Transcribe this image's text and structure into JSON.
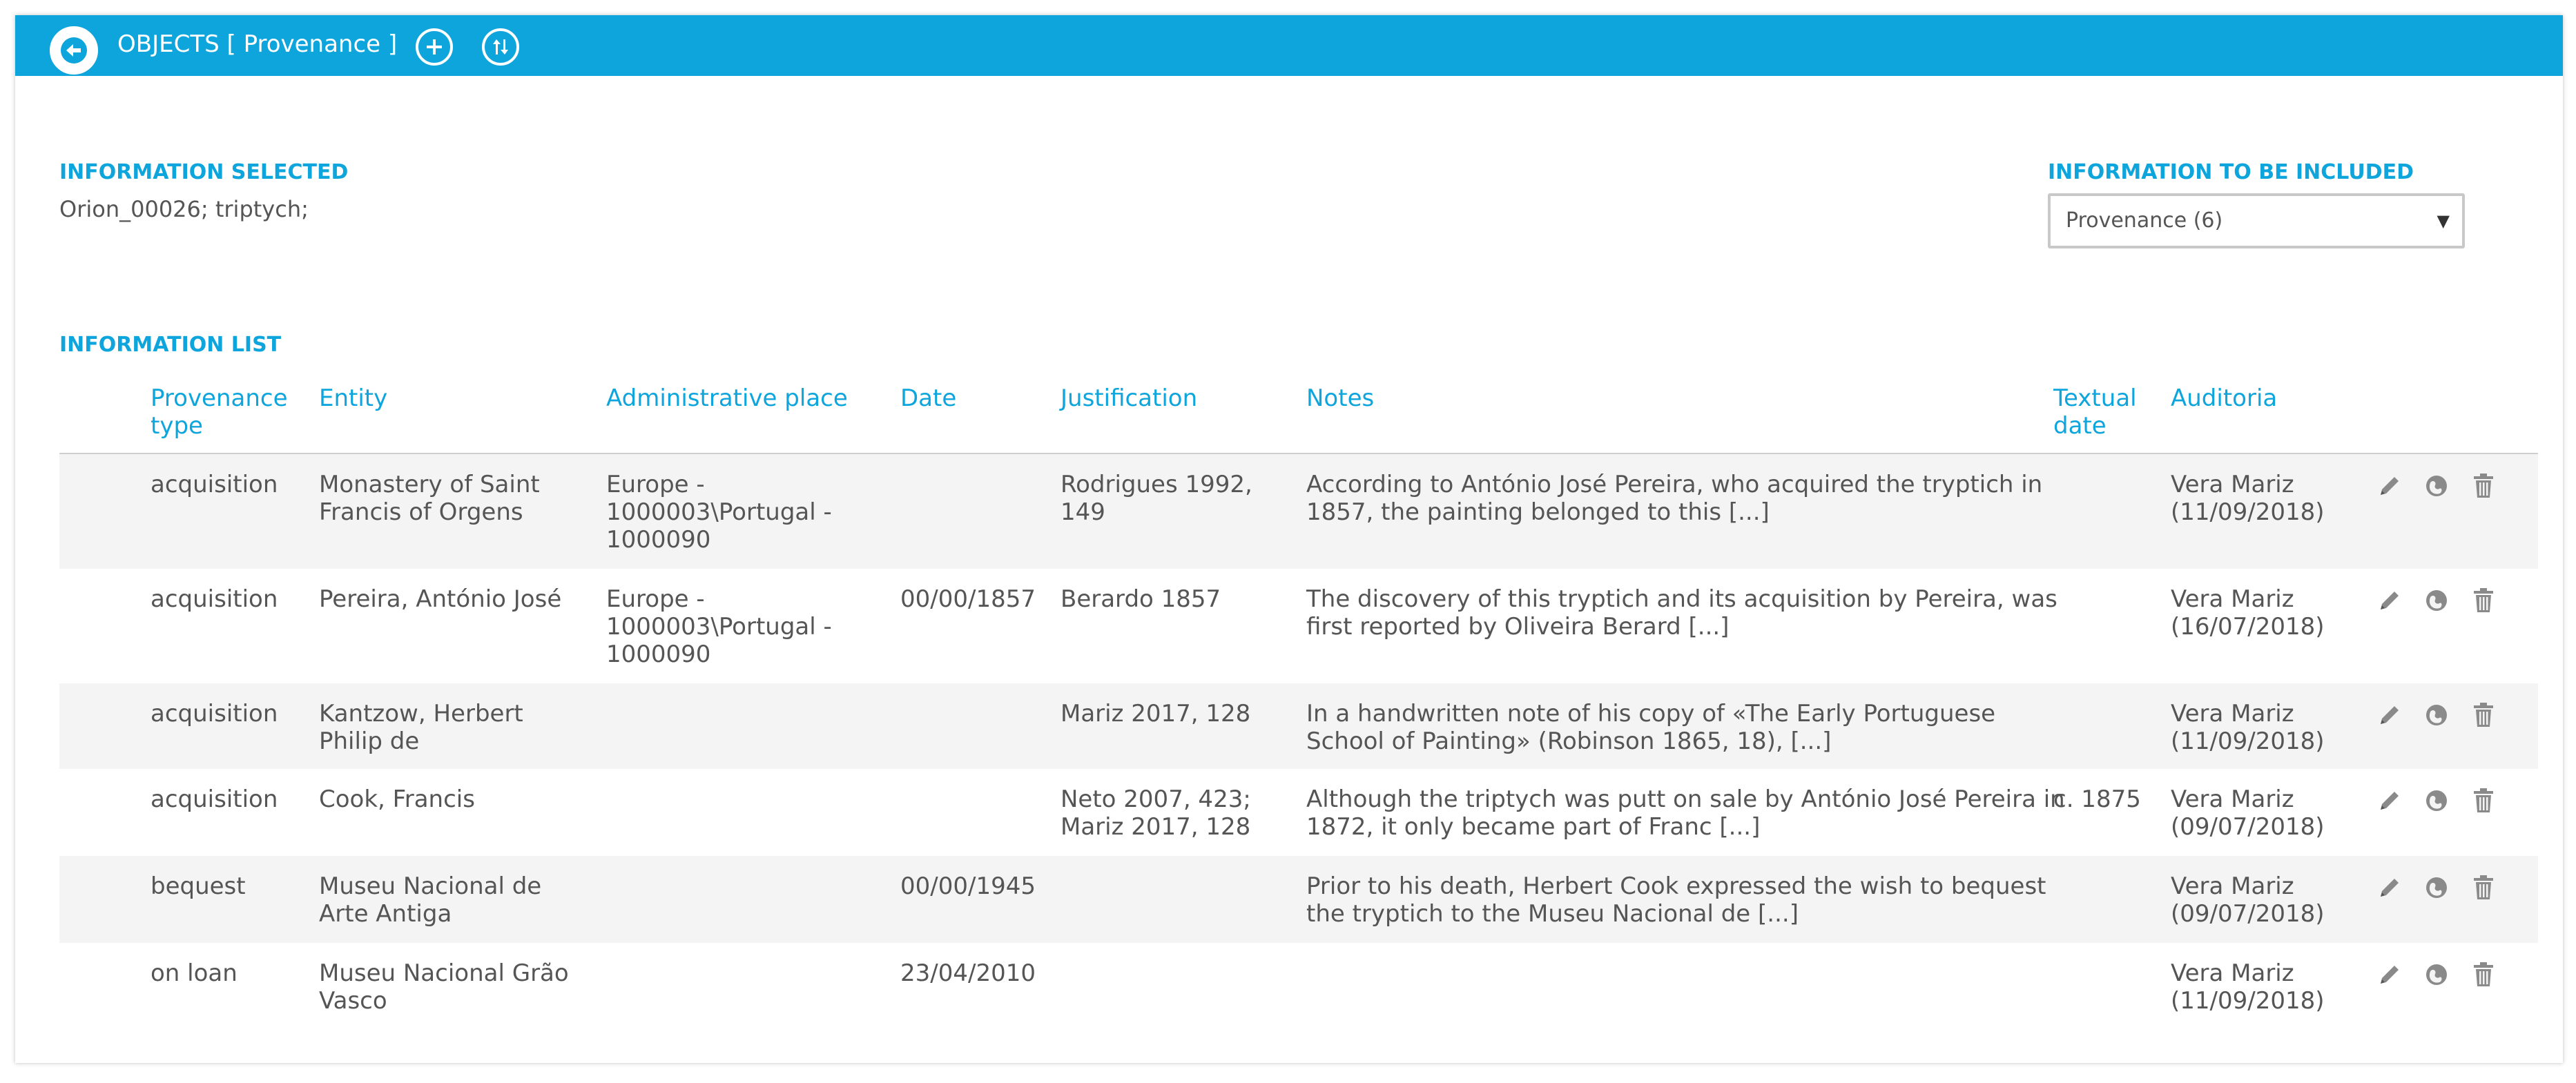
{
  "header": {
    "title": "OBJECTS [ Provenance ]",
    "back_icon": "arrow-left-icon",
    "add_icon": "plus-icon",
    "sort_icon": "sort-arrows-icon"
  },
  "info_selected": {
    "label": "INFORMATION SELECTED",
    "value": "Orion_00026; triptych;"
  },
  "info_included": {
    "label": "INFORMATION TO BE INCLUDED",
    "selected": "Provenance (6)"
  },
  "list": {
    "label": "INFORMATION LIST",
    "columns": [
      "Provenance\ntype",
      "Entity",
      "Administrative place",
      "Date",
      "Justification",
      "Notes",
      "Textual\ndate",
      "Auditoria"
    ],
    "rows": [
      {
        "type": "acquisition",
        "entity": "Monastery of Saint\nFrancis of Orgens",
        "place": "Europe -\n1000003\\Portugal -\n1000090",
        "date": "",
        "justification": "Rodrigues 1992,\n149",
        "notes": "According to António José Pereira, who acquired the tryptich in\n1857, the painting belonged to this [...]",
        "textual_date": "",
        "audit": "Vera Mariz\n(11/09/2018)"
      },
      {
        "type": "acquisition",
        "entity": "Pereira, António José",
        "place": "Europe -\n1000003\\Portugal -\n1000090",
        "date": "00/00/1857",
        "justification": "Berardo 1857",
        "notes": "The discovery of this tryptich and its acquisition by Pereira, was\nfirst reported by Oliveira Berard [...]",
        "textual_date": "",
        "audit": "Vera Mariz\n(16/07/2018)"
      },
      {
        "type": "acquisition",
        "entity": "Kantzow, Herbert\nPhilip de",
        "place": "",
        "date": "",
        "justification": "Mariz 2017, 128",
        "notes": "In a handwritten note of his copy of «The Early Portuguese\nSchool of Painting» (Robinson 1865, 18), [...]",
        "textual_date": "",
        "audit": "Vera Mariz\n(11/09/2018)"
      },
      {
        "type": "acquisition",
        "entity": "Cook, Francis",
        "place": "",
        "date": "",
        "justification": "Neto 2007, 423;\nMariz 2017, 128",
        "notes": "Although the triptych was putt on sale by António José Pereira in\n1872, it only became part of Franc [...]",
        "textual_date": "c. 1875",
        "audit": "Vera Mariz\n(09/07/2018)"
      },
      {
        "type": "bequest",
        "entity": "Museu Nacional de\nArte Antiga",
        "place": "",
        "date": "00/00/1945",
        "justification": "",
        "notes": "Prior to his death, Herbert Cook expressed the wish to bequest\nthe tryptich to the Museu Nacional de [...]",
        "textual_date": "",
        "audit": "Vera Mariz\n(09/07/2018)"
      },
      {
        "type": "on loan",
        "entity": "Museu Nacional Grão\nVasco",
        "place": "",
        "date": "23/04/2010",
        "justification": "",
        "notes": "",
        "textual_date": "",
        "audit": "Vera Mariz\n(11/09/2018)"
      }
    ]
  },
  "row_action_icons": [
    "pencil-icon",
    "globe-icon",
    "trash-icon"
  ]
}
